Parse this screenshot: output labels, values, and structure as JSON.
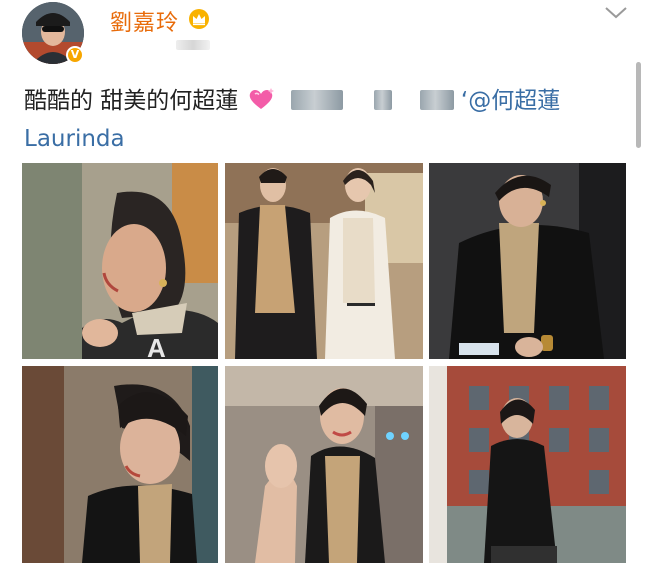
{
  "post": {
    "author": {
      "name": "劉嘉玲",
      "verified_badge": "V"
    },
    "text": {
      "part1": "酷酷的 甜美的何超蓮",
      "mention": "@何超蓮",
      "mention_continued": "Laurinda"
    },
    "icons": {
      "avatar": "avatar-image",
      "crown": "crown-icon",
      "heart": "sparkling-heart-icon",
      "menu": "chevron-down-icon"
    },
    "photos": [
      {
        "label": "photo-1"
      },
      {
        "label": "photo-2"
      },
      {
        "label": "photo-3"
      },
      {
        "label": "photo-4"
      },
      {
        "label": "photo-5"
      },
      {
        "label": "photo-6"
      }
    ]
  },
  "colors": {
    "username": "#e86b0a",
    "mention": "#3a6ea5",
    "verified": "#f7a600"
  }
}
